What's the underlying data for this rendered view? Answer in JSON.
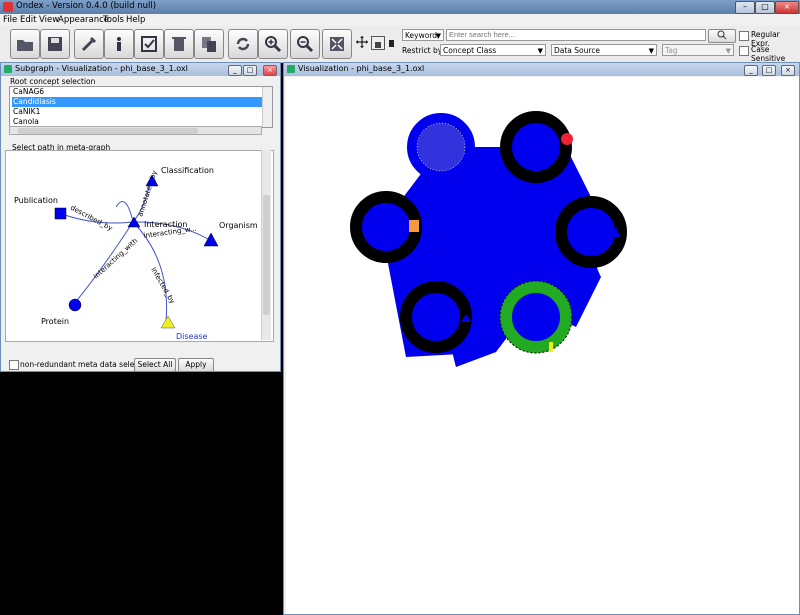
{
  "window": {
    "title": "Ondex - Version 0.4.0 (build null)"
  },
  "menu": [
    "File",
    "Edit",
    "View",
    "Appearance",
    "Tools",
    "Help"
  ],
  "search": {
    "mode": "Keyword",
    "placeholder": "Enter search here...",
    "restrict_label": "Restrict by:",
    "concept_class": "Concept Class",
    "data_source": "Data Source",
    "tag": "Tag",
    "regular_expr": "Regular Expr.",
    "case_sensitive": "Case Sensitive"
  },
  "subgraph": {
    "title": "Subgraph - Visualization - phi_base_3_1.oxl",
    "root_label": "Root concept selection",
    "root_items": [
      "CaNAG6",
      "Candidiasis",
      "CaNIK1",
      "Canola"
    ],
    "selected_index": 1,
    "path_label": "Select path in meta-graph",
    "nodes": [
      "Classification",
      "Publication",
      "Organism",
      "Interaction",
      "Protein",
      "Disease"
    ],
    "edges": [
      "described_by",
      "annotated_by",
      "interacting_with",
      "interacting_w...",
      "interacting_...",
      "infected_by"
    ],
    "non_redundant": "non-redundant meta data selection?",
    "select_all": "Select All",
    "apply": "Apply"
  },
  "visualization": {
    "title": "Visualization - phi_base_3_1.oxl"
  },
  "colors": {
    "node_blue": "#0000ee",
    "publication_orange": "#f39a3c",
    "disease_yellow": "#eeee22",
    "selected_green": "#22aa22",
    "highlight_red": "#ee2233"
  }
}
